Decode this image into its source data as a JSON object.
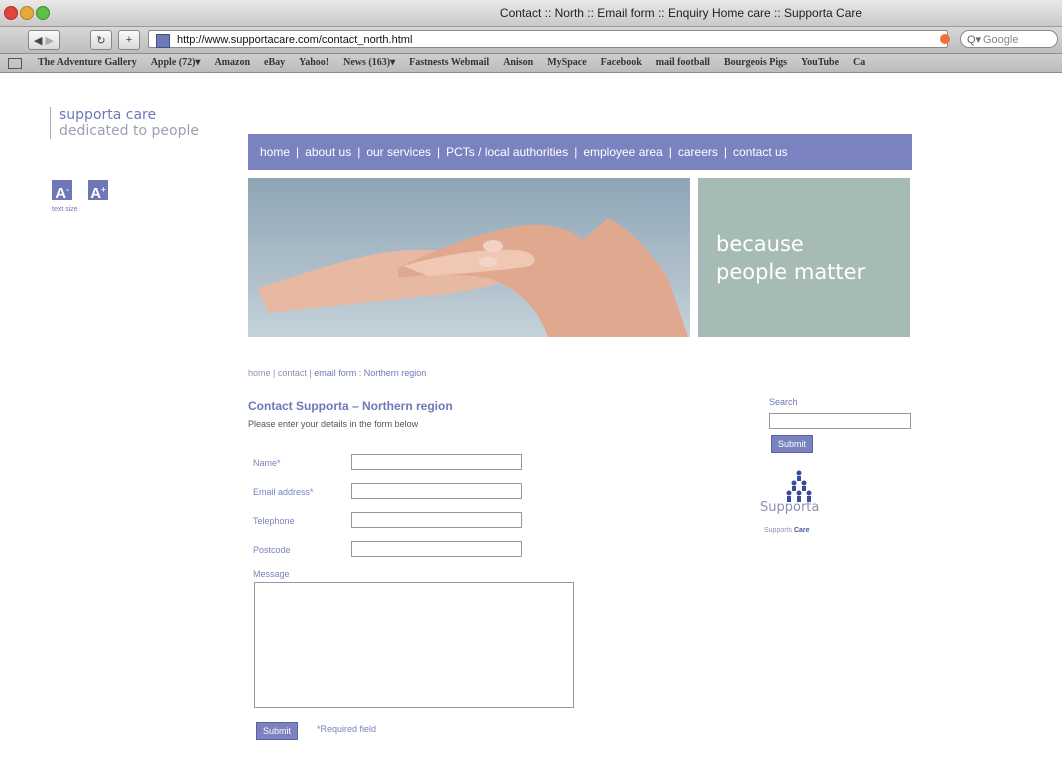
{
  "window": {
    "title": "Contact :: North :: Email form :: Enquiry Home care :: Supporta Care"
  },
  "toolbar": {
    "url": "http://www.supportacare.com/contact_north.html",
    "search_placeholder": "Google"
  },
  "bookmarks": [
    "The Adventure Gallery",
    "Apple (72)▾",
    "Amazon",
    "eBay",
    "Yahoo!",
    "News (163)▾",
    "Fastnests Webmail",
    "Anison",
    "MySpace",
    "Facebook",
    "mail football",
    "Bourgeois Pigs",
    "YouTube",
    "Ca"
  ],
  "logo": {
    "line1": "supporta care",
    "line2": "dedicated to people"
  },
  "text_size": {
    "decrease": "A",
    "increase": "A",
    "label": "text size"
  },
  "nav": [
    "home",
    "about us",
    "our services",
    "PCTs / local authorities",
    "employee area",
    "careers",
    "contact us"
  ],
  "hero": {
    "tagline_line1": "because",
    "tagline_line2": "people matter"
  },
  "breadcrumb": {
    "home": "home",
    "contact": "contact",
    "current": "email form : Northern region"
  },
  "form": {
    "title": "Contact Supporta – Northern region",
    "subtitle": "Please enter your details in the form below",
    "name_label": "Name*",
    "email_label": "Email address*",
    "telephone_label": "Telephone",
    "postcode_label": "Postcode",
    "message_label": "Message",
    "submit_label": "Submit",
    "required_note": "*Required field"
  },
  "sidebar": {
    "search_label": "Search",
    "submit_label": "Submit",
    "brand_name": "Supporta",
    "brand_sub_prefix": "Supports",
    "brand_sub_bold": "Care"
  },
  "colors": {
    "accent": "#7a83c0",
    "tagline_bg": "#a6bbb5"
  }
}
